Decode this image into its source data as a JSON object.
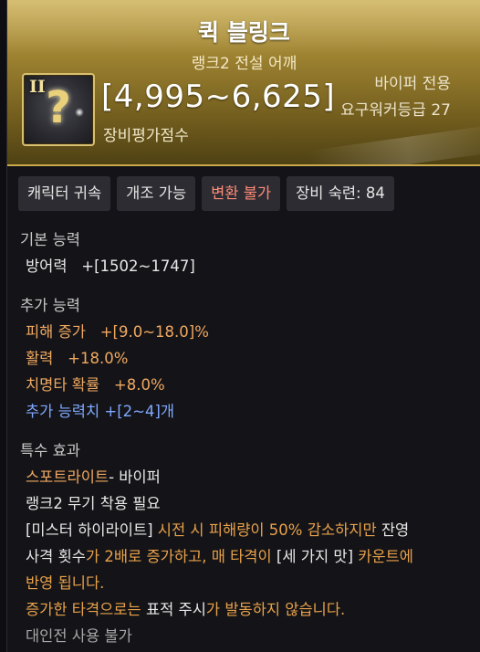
{
  "item": {
    "name": "퀵 블링크",
    "subtitle": "랭크2 전설 어깨",
    "class_only": "바이퍼 전용",
    "required_level": "요구워커등급 27",
    "rank_badge": "II",
    "score": "[4,995~6,625]",
    "score_label": "장비평가점수",
    "icon": "question-mark-shoulder-icon"
  },
  "tags": [
    {
      "label": "캐릭터 귀속",
      "color": "#e6e6e6"
    },
    {
      "label": "개조 가능",
      "color": "#e6e6e6"
    },
    {
      "label": "변환 불가",
      "color": "#ff8b77"
    },
    {
      "label": "장비 숙련: 84",
      "color": "#e6e6e6"
    }
  ],
  "base": {
    "heading": "기본 능력",
    "stat_name": "방어력",
    "stat_value": "+[1502~1747]"
  },
  "extra": {
    "heading": "추가 능력",
    "lines": [
      {
        "name": "피해 증가",
        "value": "+[9.0~18.0]%"
      },
      {
        "name": "활력",
        "value": "+18.0%"
      },
      {
        "name": "치명타 확률",
        "value": "+8.0%"
      }
    ],
    "extra_stat_name": "추가 능력치",
    "extra_stat_value": "+[2~4]개"
  },
  "special": {
    "heading": "특수 효과",
    "skill_name": "스포트라이트",
    "skill_suffix": "- 바이퍼",
    "requirement": "랭크2 무기 착용 필요",
    "d1_a": "[미스터 하이라이트]",
    "d1_b": " 시전 시 피해량이 50% 감소하지만 ",
    "d1_c": "잔영",
    "d2_a": "사격 횟수",
    "d2_b": "가 2배로 증가하고, 매 타격이 ",
    "d2_c": "[세 가지 맛]",
    "d2_d": " 카운트에",
    "d3": "반영 됩니다.",
    "d4_a": "증가한 타격으로는 ",
    "d4_b": "표적 주시",
    "d4_c": "가 발동하지 않습니다.",
    "pvp_note": "대인전 사용 불가"
  },
  "colors": {
    "header_gold": "#9c8130",
    "warn": "#ff8b77",
    "stat_orange": "#f0a860",
    "extra_blue": "#7fa8ff"
  }
}
